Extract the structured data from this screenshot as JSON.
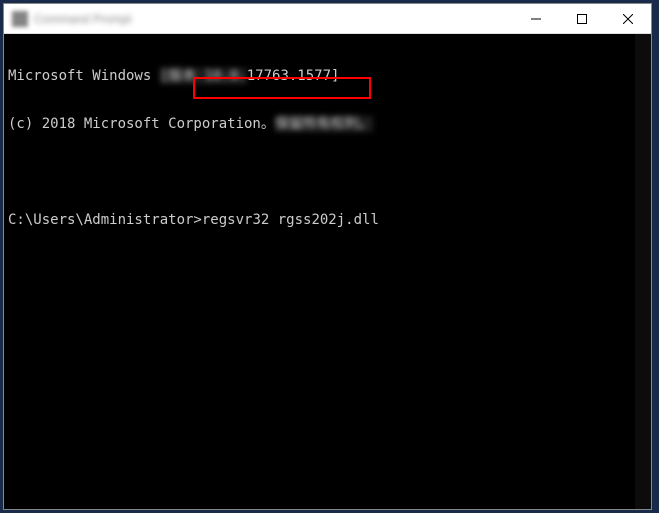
{
  "titlebar": {
    "title": "Command Prompt"
  },
  "terminal": {
    "line1_prefix": "Microsoft Windows ",
    "line1_blurred": "[版本 10.0.",
    "line1_suffix": "17763.1577]",
    "line2_prefix": "(c) 2018 Microsoft Corporation。",
    "line2_blurred": "保留所有权利。",
    "prompt": "C:\\Users\\Administrator>",
    "command": "regsvr32 rgss202j.dll"
  },
  "controls": {
    "minimize": "minimize",
    "maximize": "maximize",
    "close": "close"
  }
}
